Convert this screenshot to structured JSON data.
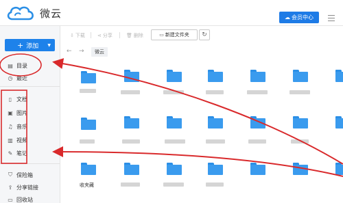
{
  "app": {
    "brand": "微云",
    "vip_label": "会员中心"
  },
  "sidebar": {
    "add_label": "添加",
    "primary": [
      {
        "icon": "list-icon",
        "glyph": "▤",
        "label": "目录"
      },
      {
        "icon": "clock-icon",
        "glyph": "◷",
        "label": "最近"
      }
    ],
    "categories": [
      {
        "icon": "document-icon",
        "glyph": "▯",
        "label": "文档"
      },
      {
        "icon": "image-icon",
        "glyph": "▣",
        "label": "图片"
      },
      {
        "icon": "music-icon",
        "glyph": "♫",
        "label": "音乐"
      },
      {
        "icon": "video-icon",
        "glyph": "▥",
        "label": "视频"
      },
      {
        "icon": "note-icon",
        "glyph": "✎",
        "label": "笔记"
      }
    ],
    "extra": [
      {
        "icon": "safe-icon",
        "glyph": "⛉",
        "label": "保险箱"
      },
      {
        "icon": "share-icon",
        "glyph": "⇪",
        "label": "分享链接"
      },
      {
        "icon": "recycle-bin-icon",
        "glyph": "▭",
        "label": "回收站"
      }
    ]
  },
  "toolbar": {
    "download_label": "下载",
    "share_label": "分享",
    "delete_label": "删除",
    "new_folder_label": "新建文件夹"
  },
  "breadcrumb": {
    "current": "微云"
  },
  "grid": {
    "visible_folder_name": "收夹藏"
  },
  "colors": {
    "accent": "#1e82ea",
    "folder": "#3a9bee",
    "annotation": "#d9292b"
  }
}
